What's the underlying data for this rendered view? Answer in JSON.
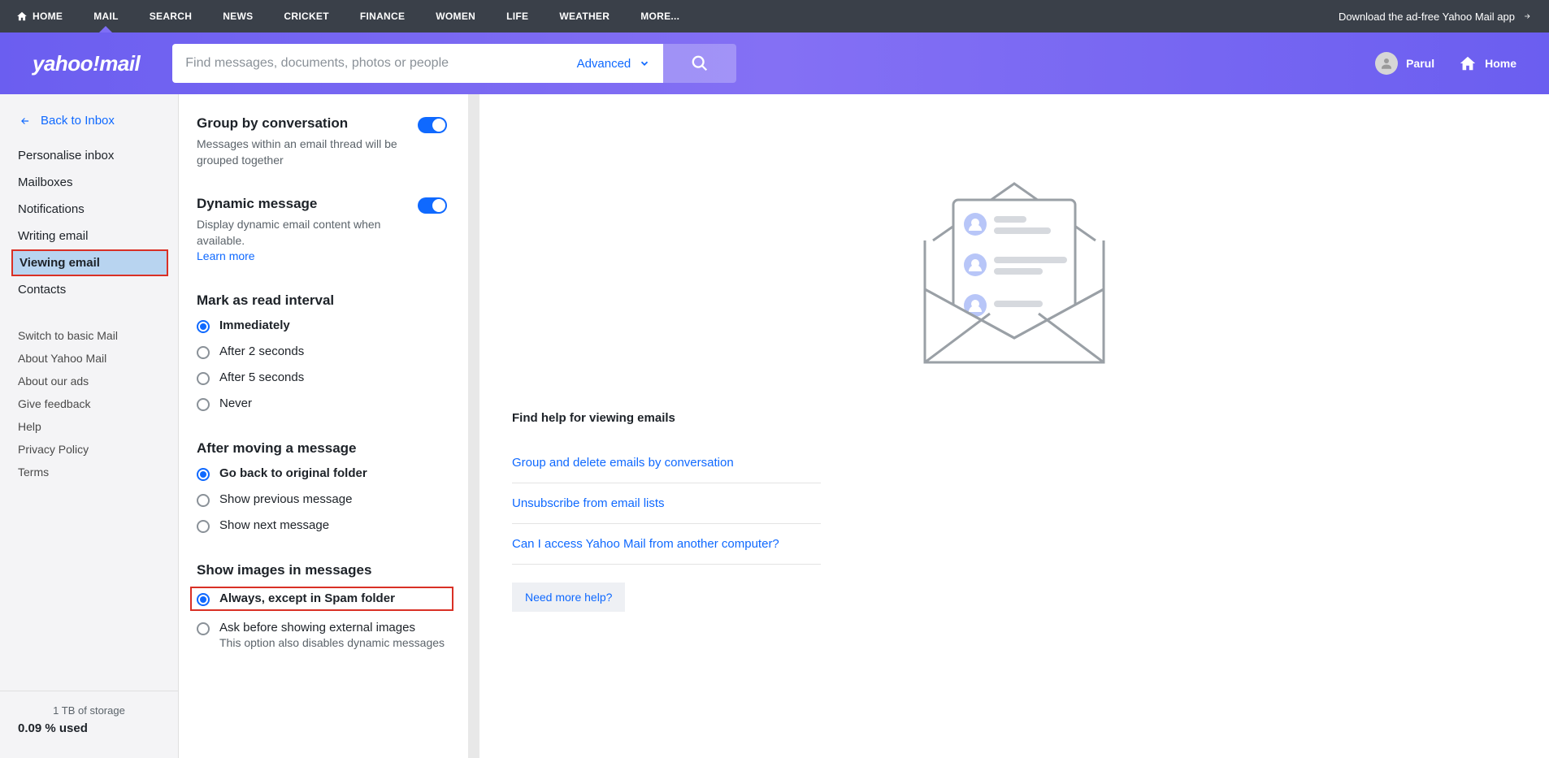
{
  "topnav": {
    "items": [
      "HOME",
      "MAIL",
      "SEARCH",
      "NEWS",
      "CRICKET",
      "FINANCE",
      "WOMEN",
      "LIFE",
      "WEATHER",
      "MORE..."
    ],
    "download": "Download the ad-free Yahoo Mail app"
  },
  "header": {
    "logo": "yahoo!mail",
    "search_placeholder": "Find messages, documents, photos or people",
    "advanced": "Advanced",
    "user_name": "Parul",
    "home": "Home"
  },
  "sidebar": {
    "back": "Back to Inbox",
    "items": [
      "Personalise inbox",
      "Mailboxes",
      "Notifications",
      "Writing email",
      "Viewing email",
      "Contacts"
    ],
    "items2": [
      "Switch to basic Mail",
      "About Yahoo Mail",
      "About our ads",
      "Give feedback",
      "Help",
      "Privacy Policy",
      "Terms"
    ],
    "storage_line": "1 TB of storage",
    "storage_used": "0.09 % used"
  },
  "settings": {
    "group_title": "Group by conversation",
    "group_desc": "Messages within an email thread will be grouped together",
    "dynamic_title": "Dynamic message",
    "dynamic_desc": "Display dynamic email content when available.",
    "learn_more": "Learn more",
    "mark_title": "Mark as read interval",
    "mark_opts": [
      "Immediately",
      "After 2 seconds",
      "After 5 seconds",
      "Never"
    ],
    "move_title": "After moving a message",
    "move_opts": [
      "Go back to original folder",
      "Show previous message",
      "Show next message"
    ],
    "images_title": "Show images in messages",
    "images_opt1": "Always, except in Spam folder",
    "images_opt2": "Ask before showing external images",
    "images_opt2_sub": "This option also disables dynamic messages"
  },
  "help": {
    "heading": "Find help for viewing emails",
    "links": [
      "Group and delete emails by conversation",
      "Unsubscribe from email lists",
      "Can I access Yahoo Mail from another computer?"
    ],
    "more": "Need more help?"
  }
}
